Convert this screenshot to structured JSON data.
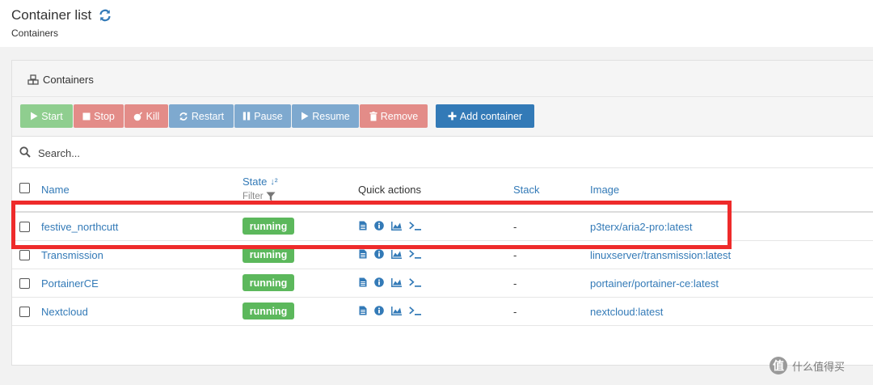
{
  "header": {
    "title": "Container list",
    "subtitle": "Containers"
  },
  "panel": {
    "title": "Containers"
  },
  "toolbar": {
    "start": "Start",
    "stop": "Stop",
    "kill": "Kill",
    "restart": "Restart",
    "pause": "Pause",
    "resume": "Resume",
    "remove": "Remove",
    "add": "Add container"
  },
  "search": {
    "placeholder": "Search..."
  },
  "table": {
    "headers": {
      "name": "Name",
      "state": "State",
      "state_sort_icon": "↓²",
      "filter": "Filter",
      "quick_actions": "Quick actions",
      "stack": "Stack",
      "image": "Image"
    },
    "rows": [
      {
        "name": "festive_northcutt",
        "state": "running",
        "stack": "-",
        "image": "p3terx/aria2-pro:latest"
      },
      {
        "name": "Transmission",
        "state": "running",
        "stack": "-",
        "image": "linuxserver/transmission:latest"
      },
      {
        "name": "PortainerCE",
        "state": "running",
        "stack": "-",
        "image": "portainer/portainer-ce:latest"
      },
      {
        "name": "Nextcloud",
        "state": "running",
        "stack": "-",
        "image": "nextcloud:latest"
      }
    ]
  },
  "watermark": {
    "logo": "值",
    "text": "什么值得买"
  },
  "colors": {
    "link": "#337ab7",
    "running": "#5cb85c",
    "highlight": "#ee2b2b",
    "add_button": "#337ab7"
  },
  "icons": [
    "refresh-icon",
    "cubes-icon",
    "play-icon",
    "stop-icon",
    "bomb-icon",
    "sync-icon",
    "pause-icon",
    "resume-icon",
    "trash-icon",
    "plus-icon",
    "search-icon",
    "sort-icon",
    "filter-icon",
    "logs-icon",
    "info-icon",
    "stats-icon",
    "console-icon"
  ]
}
